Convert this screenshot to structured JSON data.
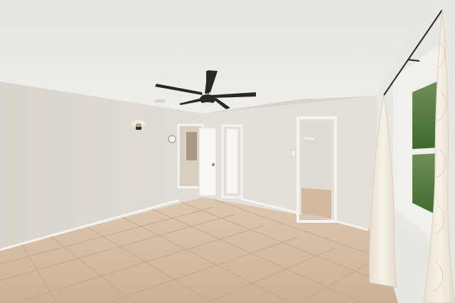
{
  "scene": {
    "subject": "empty-room-interior",
    "colors": {
      "ceiling": "#e9e8e4",
      "wall_left": "#ddd8cf",
      "wall_back": "#e3dfd8",
      "wall_right": "#e8e6e1",
      "floor": "#d7bfa6",
      "floor_grout": "#bfa68d",
      "trim": "#f4f2ee",
      "fan_dark": "#2a2826",
      "curtain": "#efe9dc",
      "window_green": "#4f7a3a"
    }
  }
}
